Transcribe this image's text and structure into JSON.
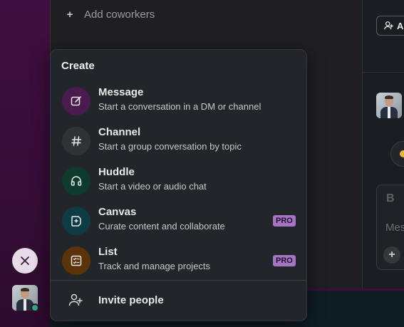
{
  "sidebar": {
    "add_coworkers": "Add coworkers"
  },
  "right_pane": {
    "top_button_label": "A",
    "composer_bold": "B",
    "composer_placeholder": "Mes"
  },
  "menu": {
    "title": "Create",
    "items": [
      {
        "name": "Message",
        "description": "Start a conversation in a DM or channel",
        "icon": "compose-icon",
        "icon_bg": "#4a1b4e",
        "pro": ""
      },
      {
        "name": "Channel",
        "description": "Start a group conversation by topic",
        "icon": "hash-icon",
        "icon_bg": "#303236",
        "pro": ""
      },
      {
        "name": "Huddle",
        "description": "Start a video or audio chat",
        "icon": "headphones-icon",
        "icon_bg": "#0d3b2e",
        "pro": ""
      },
      {
        "name": "Canvas",
        "description": "Curate content and collaborate",
        "icon": "canvas-icon",
        "icon_bg": "#0e3c44",
        "pro": "PRO"
      },
      {
        "name": "List",
        "description": "Track and manage projects",
        "icon": "list-icon",
        "icon_bg": "#5a3408",
        "pro": "PRO"
      }
    ],
    "invite": "Invite people"
  },
  "colors": {
    "rail": "#3f0e40",
    "pro_badge": "#a574c4",
    "presence": "#2bac76"
  }
}
